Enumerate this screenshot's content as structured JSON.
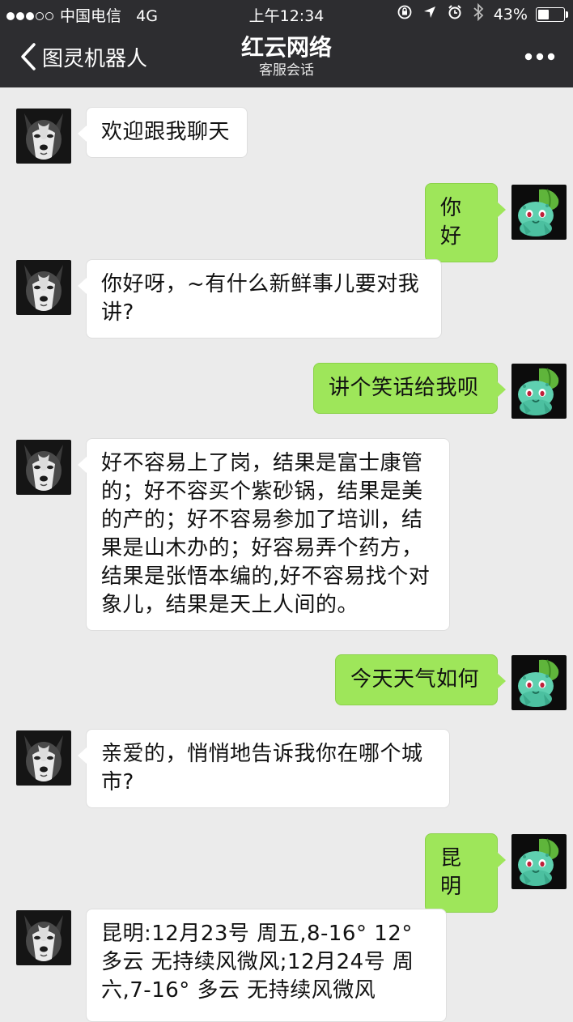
{
  "status_bar": {
    "carrier": "中国电信",
    "network": "4G",
    "time": "上午12:34",
    "battery": "43%",
    "battery_level": 0.43
  },
  "nav": {
    "back_label": "图灵机器人",
    "title": "红云网络",
    "subtitle": "客服会话"
  },
  "colors": {
    "header_bg": "#2d2d30",
    "chat_bg": "#ebebeb",
    "bubble_left": "#ffffff",
    "bubble_right": "#9ee65a"
  },
  "messages": [
    {
      "side": "left",
      "avatar": "husky-avatar",
      "text": "欢迎跟我聊天"
    },
    {
      "side": "right",
      "avatar": "bulbasaur-avatar",
      "text": "你好"
    },
    {
      "side": "left",
      "avatar": "husky-avatar",
      "text": "你好呀，~有什么新鲜事儿要对我讲?"
    },
    {
      "side": "right",
      "avatar": "bulbasaur-avatar",
      "text": "讲个笑话给我呗"
    },
    {
      "side": "left",
      "avatar": "husky-avatar",
      "text": "好不容易上了岗，结果是富士康管的；好不容买个紫砂锅，结果是美的产的；好不容易参加了培训，结果是山木办的；好容易弄个药方，结果是张悟本编的,好不容易找个对象儿，结果是天上人间的。"
    },
    {
      "side": "right",
      "avatar": "bulbasaur-avatar",
      "text": "今天天气如何"
    },
    {
      "side": "left",
      "avatar": "husky-avatar",
      "text": "亲爱的，悄悄地告诉我你在哪个城市?"
    },
    {
      "side": "right",
      "avatar": "bulbasaur-avatar",
      "text": "昆明"
    },
    {
      "side": "left",
      "avatar": "husky-avatar",
      "text": "昆明:12月23号 周五,8-16° 12° 多云 无持续风微风;12月24号 周六,7-16° 多云 无持续风微风"
    }
  ]
}
